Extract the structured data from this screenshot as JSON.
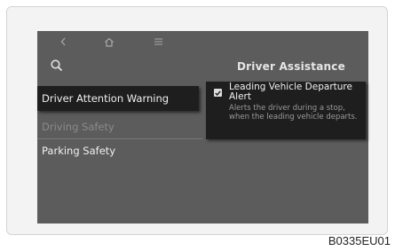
{
  "screen": {
    "header_title": "Driver Assistance",
    "icons": {
      "back": "chevron-left-icon",
      "home": "home-icon",
      "menu": "menu-icon",
      "search": "search-icon"
    }
  },
  "menu": {
    "items": [
      {
        "label": "Driver Attention Warning",
        "state": "selected"
      },
      {
        "label": "Driving Safety",
        "state": "disabled"
      },
      {
        "label": "Parking Safety",
        "state": "normal"
      }
    ]
  },
  "option": {
    "checked": true,
    "title": "Leading Vehicle Departure Alert",
    "description": "Alerts the driver during a stop, when the leading vehicle departs."
  },
  "figure_code": "B0335EU01",
  "colors": {
    "screen_bg": "#5c5c5c",
    "selected_bg": "#1e1e1e",
    "text_light": "#f0f0f0",
    "text_dim": "#8a8a8a"
  }
}
